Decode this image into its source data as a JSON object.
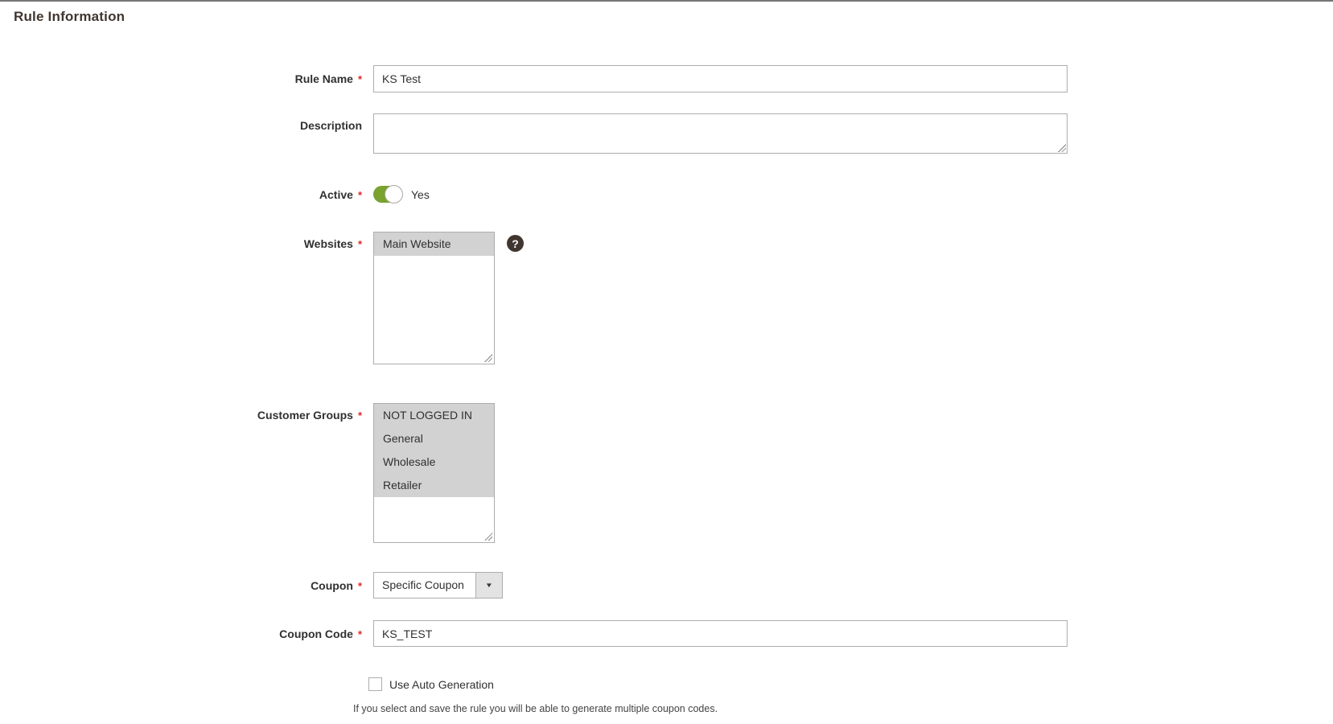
{
  "page": {
    "title": "Rule Information"
  },
  "form": {
    "rule_name": {
      "label": "Rule Name",
      "required_mark": "*",
      "value": "KS Test"
    },
    "description": {
      "label": "Description",
      "value": ""
    },
    "active": {
      "label": "Active",
      "required_mark": "*",
      "state_label": "Yes",
      "state": "on"
    },
    "websites": {
      "label": "Websites",
      "required_mark": "*",
      "options": [
        "Main Website"
      ],
      "selected": [
        "Main Website"
      ]
    },
    "customer_groups": {
      "label": "Customer Groups",
      "required_mark": "*",
      "options": [
        "NOT LOGGED IN",
        "General",
        "Wholesale",
        "Retailer"
      ],
      "selected": [
        "NOT LOGGED IN",
        "General",
        "Wholesale",
        "Retailer"
      ]
    },
    "coupon": {
      "label": "Coupon",
      "required_mark": "*",
      "value": "Specific Coupon"
    },
    "coupon_code": {
      "label": "Coupon Code",
      "required_mark": "*",
      "value": "KS_TEST"
    },
    "auto_generation": {
      "label": "Use Auto Generation",
      "checked": false,
      "note": "If you select and save the rule you will be able to generate multiple coupon codes."
    }
  },
  "icons": {
    "help": "?",
    "dropdown_arrow": "▼"
  },
  "colors": {
    "toggle_on": "#79a22e",
    "required_mark": "#e22626",
    "selected_option_bg": "#d2d2d2",
    "help_icon_bg": "#41362f",
    "input_border": "#adadad"
  }
}
